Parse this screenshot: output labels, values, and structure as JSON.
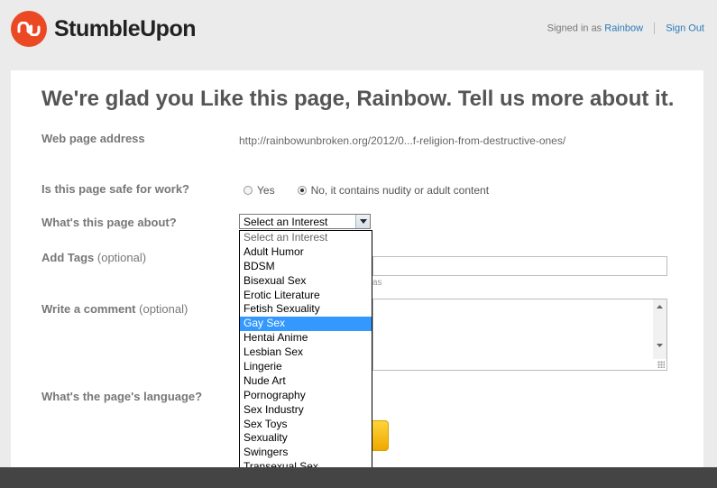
{
  "header": {
    "brand": "StumbleUpon",
    "signed_in_prefix": "Signed in as",
    "username": "Rainbow",
    "sign_out": "Sign Out"
  },
  "form": {
    "headline": "We're glad you Like this page, Rainbow. Tell us more about it.",
    "url_label": "Web page address",
    "url_value": "http://rainbowunbroken.org/2012/0...f-religion-from-destructive-ones/",
    "safe_label": "Is this page safe for work?",
    "safe_yes": "Yes",
    "safe_no": "No, it contains nudity or adult content",
    "safe_selected": "No, it contains nudity or adult content",
    "about_label": "What's this page about?",
    "interest_selected": "Select an Interest",
    "tags_label": "Add Tags",
    "optional": "(optional)",
    "tags_hint": "as",
    "comment_label": "Write a comment",
    "language_label": "What's the page's language?"
  },
  "interests": {
    "highlighted": "Gay Sex",
    "options": [
      "Select an Interest",
      "Adult Humor",
      "BDSM",
      "Bisexual Sex",
      "Erotic Literature",
      "Fetish Sexuality",
      "Gay Sex",
      "Hentai Anime",
      "Lesbian Sex",
      "Lingerie",
      "Nude Art",
      "Pornography",
      "Sex Industry",
      "Sex Toys",
      "Sexuality",
      "Swingers",
      "Transexual Sex"
    ]
  },
  "colors": {
    "brand": "#eb4924",
    "link": "#2a7ab8",
    "highlight": "#3399ff",
    "button": "#f0a800"
  }
}
